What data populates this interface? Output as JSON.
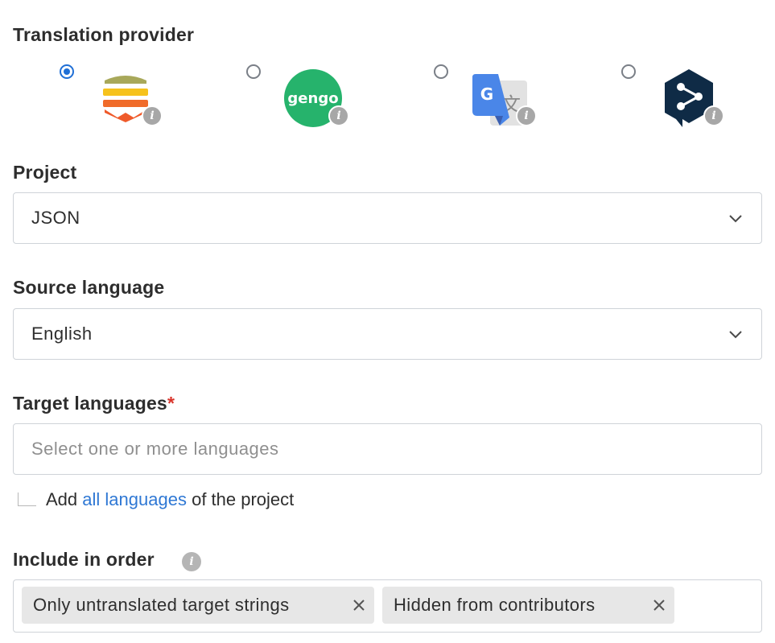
{
  "translation_provider": {
    "label": "Translation provider",
    "options": [
      {
        "name": "Lokalise",
        "selected": true
      },
      {
        "name": "Gengo",
        "logo_text": "gengo",
        "selected": false
      },
      {
        "name": "Google Translate",
        "logo_text": "G",
        "selected": false
      },
      {
        "name": "DeepL",
        "selected": false
      }
    ],
    "info_icon": "i"
  },
  "project": {
    "label": "Project",
    "value": "JSON"
  },
  "source_language": {
    "label": "Source language",
    "value": "English"
  },
  "target_languages": {
    "label": "Target languages",
    "required_mark": "*",
    "placeholder": "Select one or more languages",
    "hint_prefix": "Add",
    "hint_link": "all languages",
    "hint_suffix": "of the project"
  },
  "include_in_order": {
    "label": "Include in order",
    "tags": [
      {
        "label": "Only untranslated target strings"
      },
      {
        "label": "Hidden from contributors"
      }
    ]
  },
  "colors": {
    "accent": "#1f6fd6",
    "link": "#2f78d4",
    "required": "#d9342b",
    "gengo_green": "#26b36c",
    "deepl_navy": "#0f2b46",
    "google_blue": "#4a86e8"
  }
}
